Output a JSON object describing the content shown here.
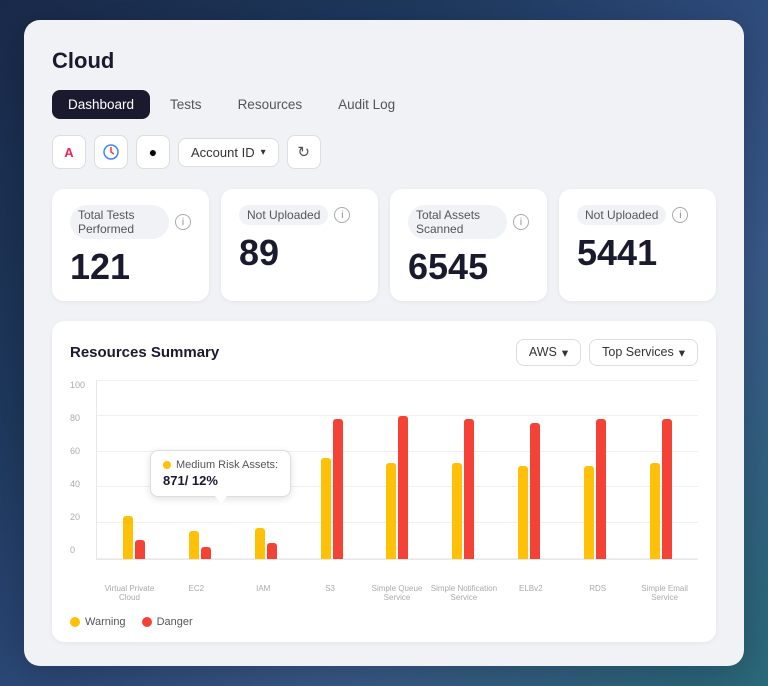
{
  "page": {
    "title": "Cloud",
    "tabs": [
      {
        "id": "dashboard",
        "label": "Dashboard",
        "active": true
      },
      {
        "id": "tests",
        "label": "Tests",
        "active": false
      },
      {
        "id": "resources",
        "label": "Resources",
        "active": false
      },
      {
        "id": "audit-log",
        "label": "Audit Log",
        "active": false
      }
    ]
  },
  "toolbar": {
    "account_id_label": "Account ID",
    "icons": [
      "A",
      "G",
      "●"
    ]
  },
  "stats": [
    {
      "id": "total-tests",
      "label": "Total Tests Performed",
      "value": "121"
    },
    {
      "id": "not-uploaded-tests",
      "label": "Not Uploaded",
      "value": "89"
    },
    {
      "id": "total-assets",
      "label": "Total Assets Scanned",
      "value": "6545"
    },
    {
      "id": "not-uploaded-assets",
      "label": "Not Uploaded",
      "value": "5441"
    }
  ],
  "chart": {
    "title": "Resources Summary",
    "aws_label": "AWS",
    "top_services_label": "Top Services",
    "y_axis": [
      "100",
      "80",
      "60",
      "40",
      "20",
      "0"
    ],
    "tooltip": {
      "label": "Medium Risk Assets:",
      "value": "871/ 12%"
    },
    "bars": [
      {
        "label": "Virtual Private Cloud",
        "warning": 28,
        "danger": 12
      },
      {
        "label": "EC2",
        "warning": 18,
        "danger": 8
      },
      {
        "label": "IAM",
        "warning": 20,
        "danger": 10
      },
      {
        "label": "S3",
        "warning": 65,
        "danger": 90
      },
      {
        "label": "Simple Queue Service",
        "warning": 62,
        "danger": 92
      },
      {
        "label": "Simple Notification Service",
        "warning": 62,
        "danger": 90
      },
      {
        "label": "ELBv2",
        "warning": 60,
        "danger": 88
      },
      {
        "label": "RDS",
        "warning": 60,
        "danger": 90
      },
      {
        "label": "Simple Email Service",
        "warning": 62,
        "danger": 90
      }
    ],
    "legend": [
      {
        "color": "#FFC107",
        "label": "Warning"
      },
      {
        "color": "#F44336",
        "label": "Danger"
      }
    ]
  }
}
